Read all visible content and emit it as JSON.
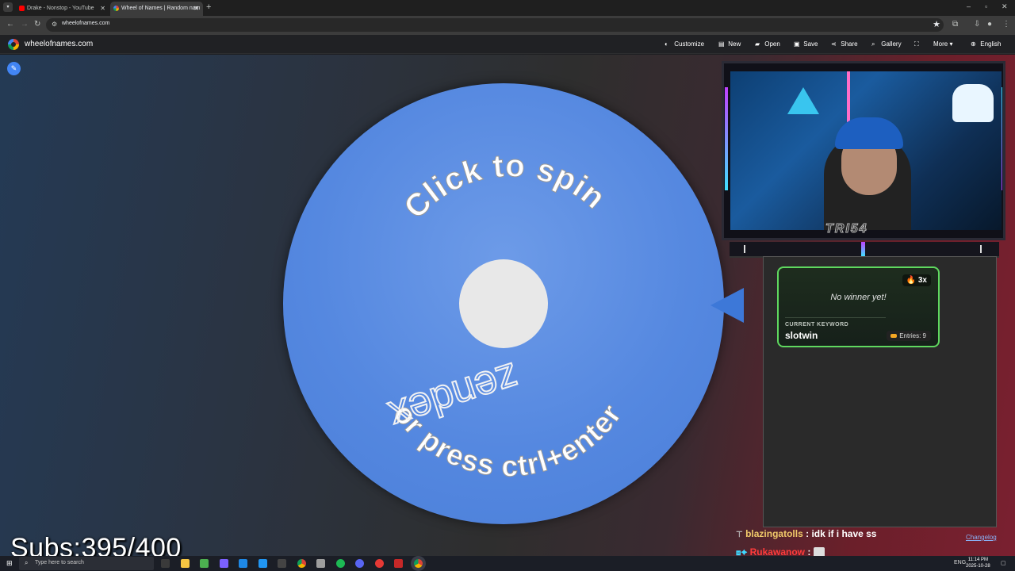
{
  "browser": {
    "tabs": [
      {
        "title": "Drake - Nonstop - YouTube",
        "active": false
      },
      {
        "title": "Wheel of Names | Random nam",
        "active": true
      }
    ],
    "new_tab": "+",
    "url": "wheelofnames.com"
  },
  "app": {
    "site_name": "wheelofnames.com",
    "menu": [
      "Customize",
      "New",
      "Open",
      "Save",
      "Share",
      "Gallery",
      "More",
      "English"
    ]
  },
  "wheel": {
    "top_text": "Click to spin",
    "bottom_text": "or press ctrl+enter",
    "watermark": "zendex",
    "color": "#5588e0"
  },
  "winner_card": {
    "streak": "3x",
    "status": "No winner yet!",
    "keyword_label": "CURRENT KEYWORD",
    "keyword": "slotwin",
    "entries": "Entries: 9"
  },
  "stream": {
    "cam_label": "TRI54",
    "subs": "Subs:395/400",
    "chat": [
      {
        "user": "blazingatolls",
        "message": "idk if i have ss"
      },
      {
        "user": "Rukawanow",
        "message": ""
      }
    ],
    "changelog": "Changelog"
  },
  "taskbar": {
    "search_placeholder": "Type here to search",
    "lang": "ENG",
    "time": "11:14 PM",
    "date": "2025-10-28"
  },
  "icons": {
    "pen": "pencil-icon",
    "search": "search-icon"
  }
}
